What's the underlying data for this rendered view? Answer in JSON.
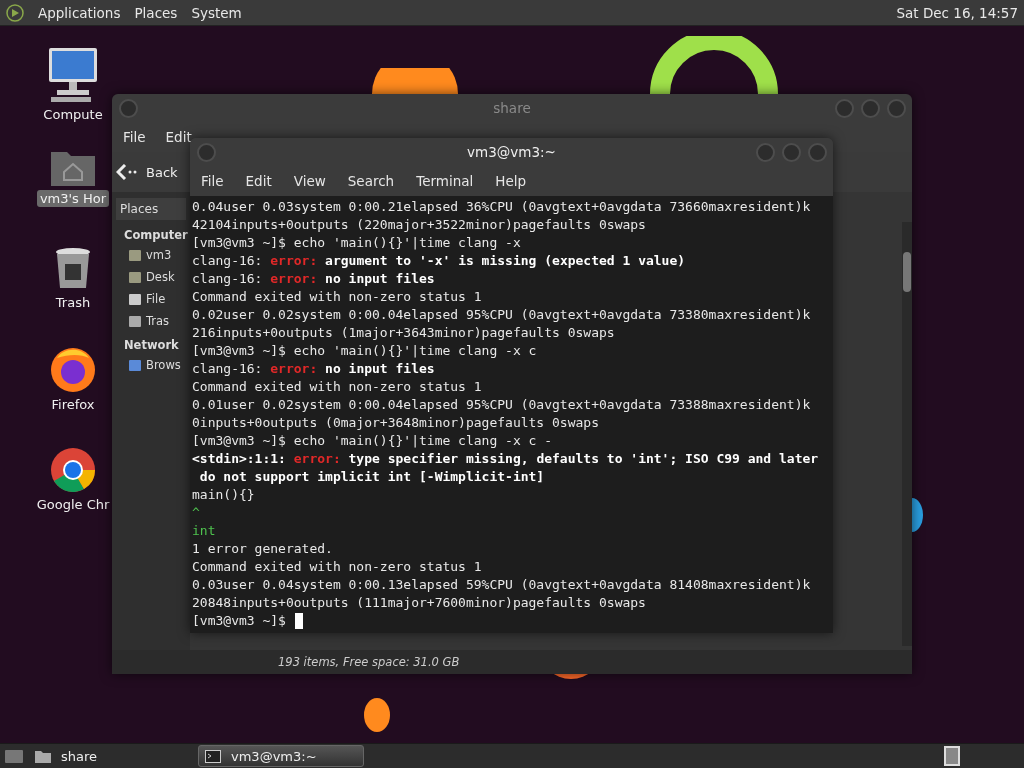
{
  "top_panel": {
    "menus": [
      "Applications",
      "Places",
      "System"
    ],
    "clock": "Sat Dec 16, 14:57"
  },
  "desktop_icons": [
    {
      "label": "Compute",
      "kind": "computer",
      "selected": false
    },
    {
      "label": "vm3's Hor",
      "kind": "home",
      "selected": true
    },
    {
      "label": "Trash",
      "kind": "trash",
      "selected": false
    },
    {
      "label": "Firefox",
      "kind": "firefox",
      "selected": false
    },
    {
      "label": "Google Chr",
      "kind": "chrome",
      "selected": false
    }
  ],
  "file_manager": {
    "title": "share",
    "menu": [
      "File",
      "Edit"
    ],
    "back": "Back",
    "sidebar": {
      "heading": "Places",
      "sections": [
        {
          "title": "Computer",
          "items": [
            {
              "label": "vm3",
              "kind": "home"
            },
            {
              "label": "Desk",
              "kind": "desktop"
            },
            {
              "label": "File",
              "kind": "drive"
            },
            {
              "label": "Tras",
              "kind": "trash"
            }
          ]
        },
        {
          "title": "Network",
          "items": [
            {
              "label": "Brows",
              "kind": "network"
            }
          ]
        }
      ]
    },
    "status": "193 items, Free space: 31.0 GB"
  },
  "terminal": {
    "title": "vm3@vm3:~",
    "menu": [
      "File",
      "Edit",
      "View",
      "Search",
      "Terminal",
      "Help"
    ],
    "lines": [
      [
        {
          "t": "0.04user 0.03system 0:00.21elapsed 36%CPU (0avgtext+0avgdata 73660maxresident)k",
          "kind": "plain"
        }
      ],
      [
        {
          "t": "42104inputs+0outputs (220major+3522minor)pagefaults 0swaps",
          "kind": "plain"
        }
      ],
      [
        {
          "t": "[vm3@vm3 ~]$ echo 'main(){}'|time clang -x",
          "kind": "plain"
        }
      ],
      [
        {
          "t": "clang-16: ",
          "kind": "plain"
        },
        {
          "t": "error:",
          "kind": "error"
        },
        {
          "t": " argument to '-x' is missing (expected 1 value)",
          "kind": "bold"
        }
      ],
      [
        {
          "t": "clang-16: ",
          "kind": "plain"
        },
        {
          "t": "error:",
          "kind": "error"
        },
        {
          "t": " no input files",
          "kind": "bold"
        }
      ],
      [
        {
          "t": "Command exited with non-zero status 1",
          "kind": "plain"
        }
      ],
      [
        {
          "t": "0.02user 0.02system 0:00.04elapsed 95%CPU (0avgtext+0avgdata 73380maxresident)k",
          "kind": "plain"
        }
      ],
      [
        {
          "t": "216inputs+0outputs (1major+3643minor)pagefaults 0swaps",
          "kind": "plain"
        }
      ],
      [
        {
          "t": "[vm3@vm3 ~]$ echo 'main(){}'|time clang -x c",
          "kind": "plain"
        }
      ],
      [
        {
          "t": "clang-16: ",
          "kind": "plain"
        },
        {
          "t": "error:",
          "kind": "error"
        },
        {
          "t": " no input files",
          "kind": "bold"
        }
      ],
      [
        {
          "t": "Command exited with non-zero status 1",
          "kind": "plain"
        }
      ],
      [
        {
          "t": "0.01user 0.02system 0:00.04elapsed 95%CPU (0avgtext+0avgdata 73388maxresident)k",
          "kind": "plain"
        }
      ],
      [
        {
          "t": "0inputs+0outputs (0major+3648minor)pagefaults 0swaps",
          "kind": "plain"
        }
      ],
      [
        {
          "t": "[vm3@vm3 ~]$ echo 'main(){}'|time clang -x c -",
          "kind": "plain"
        }
      ],
      [
        {
          "t": "<stdin>:1:1: ",
          "kind": "bold"
        },
        {
          "t": "error:",
          "kind": "error"
        },
        {
          "t": " type specifier missing, defaults to 'int'; ISO C99 and later",
          "kind": "bold"
        }
      ],
      [
        {
          "t": " do not support implicit int [-Wimplicit-int]",
          "kind": "bold"
        }
      ],
      [
        {
          "t": "main(){}",
          "kind": "plain"
        }
      ],
      [
        {
          "t": "^",
          "kind": "hint"
        }
      ],
      [
        {
          "t": "int",
          "kind": "hint"
        }
      ],
      [
        {
          "t": "1 error generated.",
          "kind": "plain"
        }
      ],
      [
        {
          "t": "Command exited with non-zero status 1",
          "kind": "plain"
        }
      ],
      [
        {
          "t": "0.03user 0.04system 0:00.13elapsed 59%CPU (0avgtext+0avgdata 81408maxresident)k",
          "kind": "plain"
        }
      ],
      [
        {
          "t": "20848inputs+0outputs (111major+7600minor)pagefaults 0swaps",
          "kind": "plain"
        }
      ],
      [
        {
          "t": "[vm3@vm3 ~]$",
          "kind": "plain"
        }
      ]
    ]
  },
  "taskbar": {
    "tasks": [
      {
        "label": "share",
        "kind": "folder",
        "selected": false
      },
      {
        "label": "vm3@vm3:~",
        "kind": "terminal",
        "selected": true
      }
    ]
  }
}
